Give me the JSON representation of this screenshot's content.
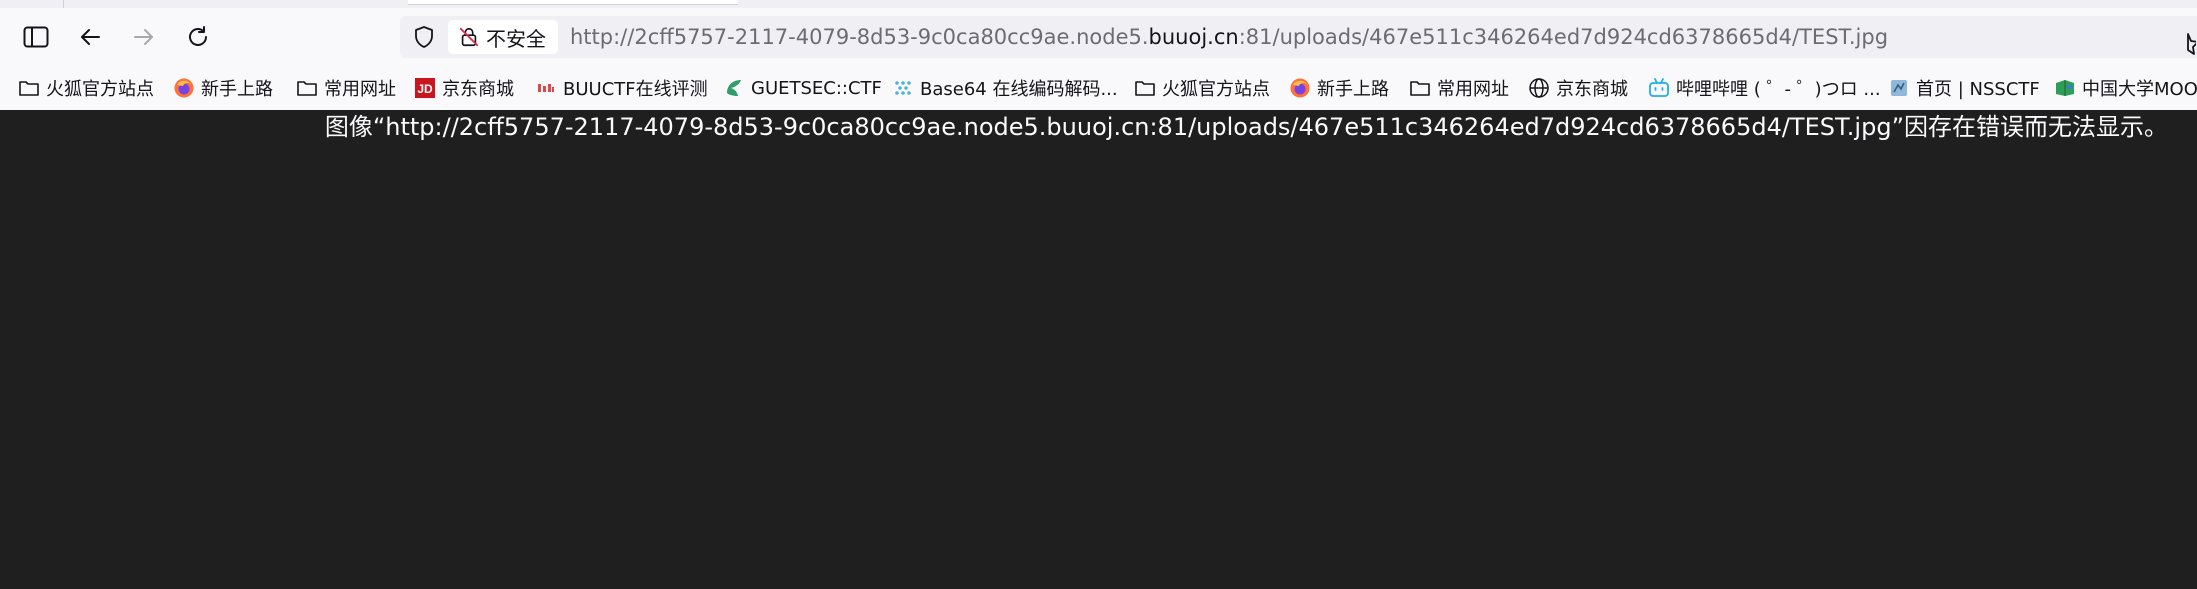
{
  "toolbar": {
    "back_label": "",
    "forward_label": "",
    "reload_label": ""
  },
  "urlbar": {
    "security_label": "不安全",
    "url_prefix": "http://2cff5757-2117-4079-8d53-9c0ca80cc9ae.node5.",
    "url_domain": "buuoj.cn",
    "url_suffix": ":81/uploads/467e511c346264ed7d924cd6378665d4/TEST.jpg"
  },
  "bookmarks": [
    {
      "label": "火狐官方站点",
      "icon": "folder-icon"
    },
    {
      "label": "新手上路",
      "icon": "firefox-icon"
    },
    {
      "label": "常用网址",
      "icon": "folder-icon"
    },
    {
      "label": "京东商城",
      "icon": "jd-icon"
    },
    {
      "label": "BUUCTF在线评测",
      "icon": "buuctf-icon"
    },
    {
      "label": "GUETSEC::CTF",
      "icon": "guetsec-icon"
    },
    {
      "label": "Base64 在线编码解码...",
      "icon": "base64-icon"
    },
    {
      "label": "火狐官方站点",
      "icon": "folder-icon"
    },
    {
      "label": "新手上路",
      "icon": "firefox-icon"
    },
    {
      "label": "常用网址",
      "icon": "folder-icon"
    },
    {
      "label": "京东商城",
      "icon": "globe-icon"
    },
    {
      "label": "哔哩哔哩 ( ゜- ゜)つロ ...",
      "icon": "bilibili-icon"
    },
    {
      "label": "首页 | NSSCTF",
      "icon": "nssctf-icon"
    },
    {
      "label": "中国大学MOOC",
      "icon": "mooc-icon"
    }
  ],
  "content": {
    "error_message": "图像“http://2cff5757-2117-4079-8d53-9c0ca80cc9ae.node5.buuoj.cn:81/uploads/467e511c346264ed7d924cd6378665d4/TEST.jpg”因存在错误而无法显示。"
  },
  "colors": {
    "page_background": "#1f1f1f",
    "toolbar_background": "#f9f9fb",
    "urlbar_background": "#f0f0f4",
    "error_text": "#fbfbfe"
  }
}
